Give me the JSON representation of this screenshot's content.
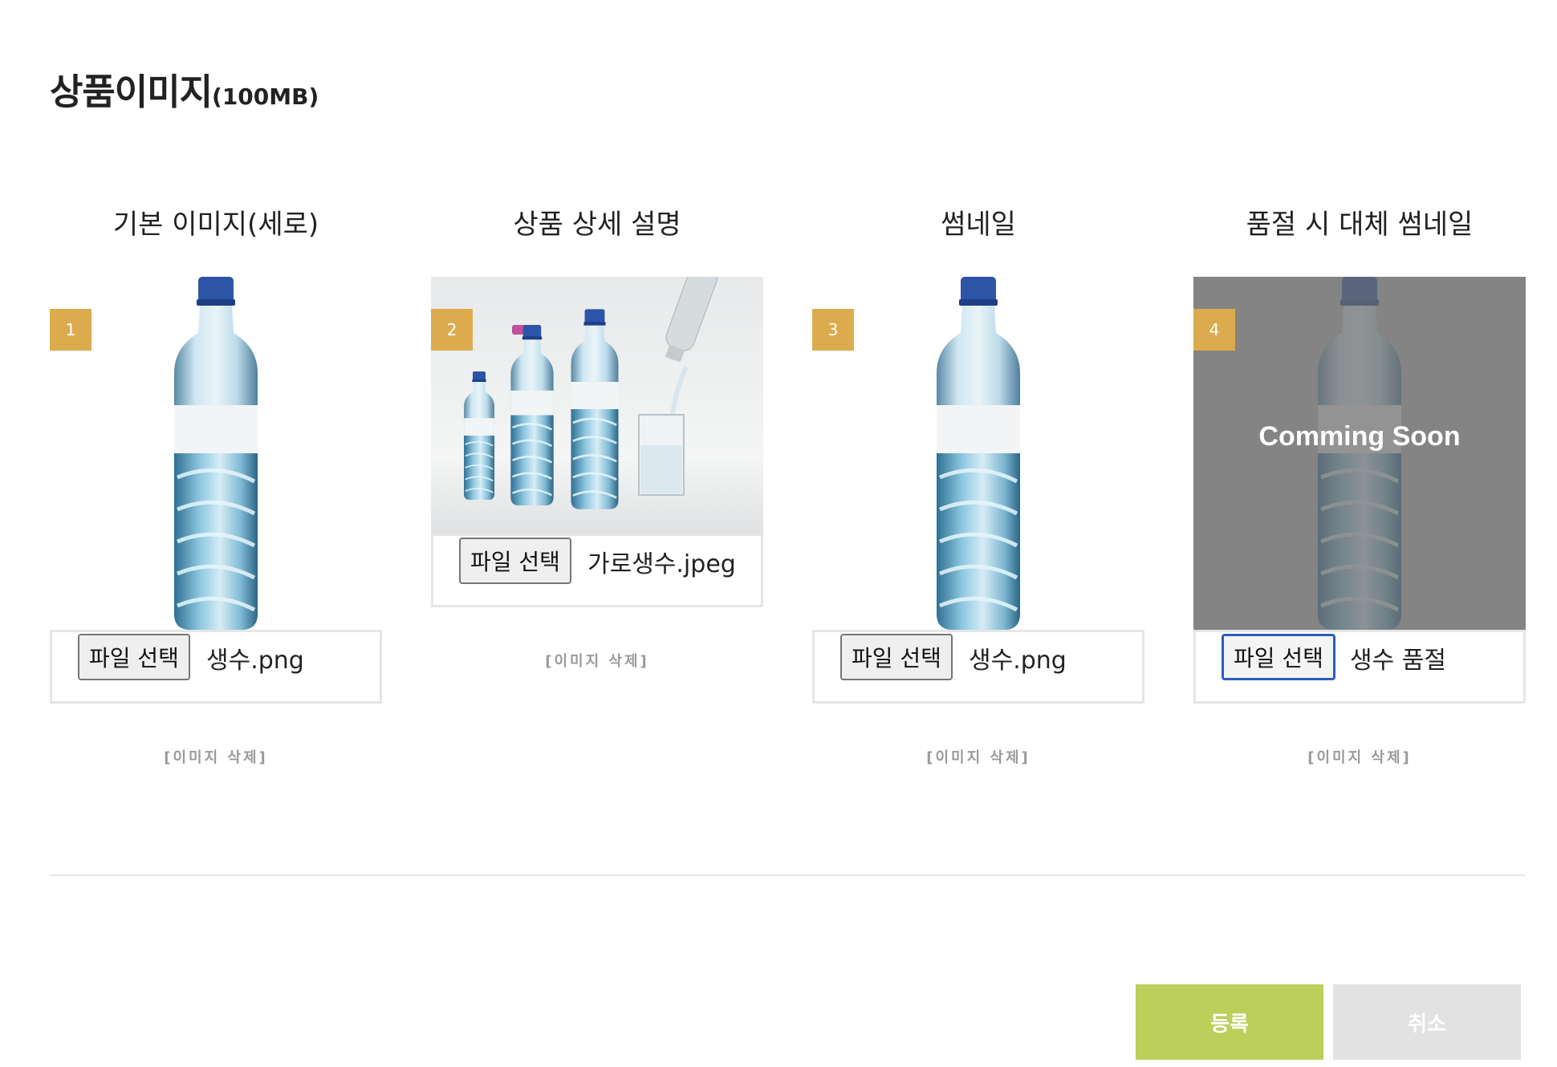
{
  "page": {
    "title": "상품이미지",
    "title_size": "(100MB)"
  },
  "slots": [
    {
      "number": "1",
      "heading": "기본 이미지(세로)",
      "file_button": "파일 선택",
      "file_name": "생수.png",
      "delete_label": "[이미지 삭제]"
    },
    {
      "number": "2",
      "heading": "상품 상세 설명",
      "file_button": "파일 선택",
      "file_name": "가로생수.jpeg",
      "delete_label": "[이미지 삭제]"
    },
    {
      "number": "3",
      "heading": "썸네일",
      "file_button": "파일 선택",
      "file_name": "생수.png",
      "delete_label": "[이미지 삭제]"
    },
    {
      "number": "4",
      "heading": "품절 시 대체 썸네일",
      "file_button": "파일 선택",
      "file_name": "생수 품절",
      "delete_label": "[이미지 삭제]",
      "overlay_text": "Comming Soon"
    }
  ],
  "actions": {
    "submit": "등록",
    "cancel": "취소"
  },
  "colors": {
    "badge": "#dcab4e",
    "submit": "#bccf5b",
    "cancel": "#e2e2e2",
    "focus": "#2b5cc2"
  }
}
